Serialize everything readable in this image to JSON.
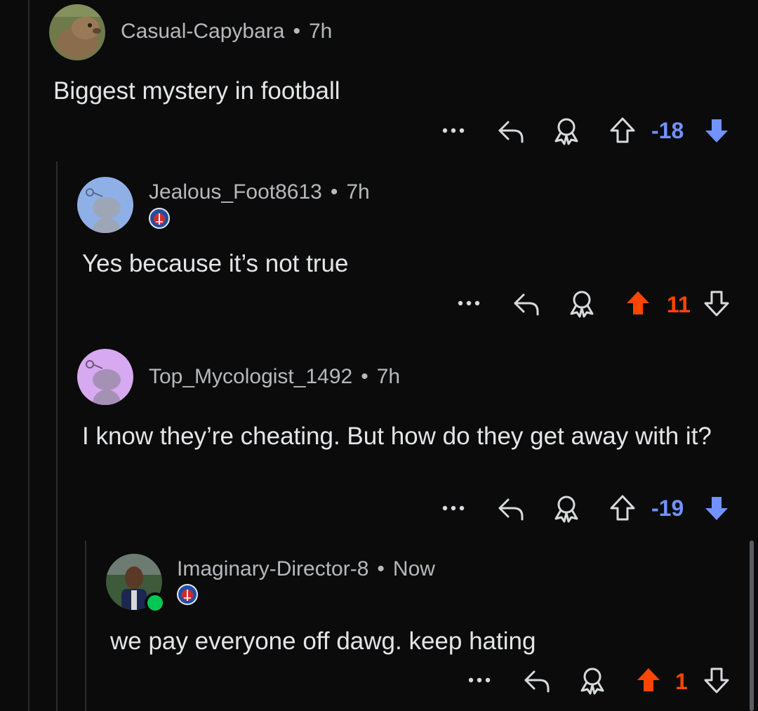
{
  "comments": [
    {
      "author": "Casual-Capybara",
      "time": "7h",
      "text": "Biggest mystery in football",
      "score": "-18",
      "vote": "down",
      "flair": false,
      "avatar": "capybara-photo"
    },
    {
      "author": "Jealous_Foot8613",
      "time": "7h",
      "text": "Yes because it’s not true",
      "score": "11",
      "vote": "up",
      "flair": true,
      "avatar": "snoo-default"
    },
    {
      "author": "Top_Mycologist_1492",
      "time": "7h",
      "text": "I know they’re cheating. But how do they get away with it?",
      "score": "-19",
      "vote": "down",
      "flair": false,
      "avatar": "snoo-default"
    },
    {
      "author": "Imaginary-Director-8",
      "time": "Now",
      "text": "we pay everyone off dawg. keep hating",
      "score": "1",
      "vote": "up",
      "flair": true,
      "avatar": "player-photo",
      "online": true
    }
  ],
  "separator": "•",
  "icons": {
    "more": "more-horizontal-icon",
    "reply": "reply-arrow-icon",
    "award": "award-icon",
    "upvote": "upvote-arrow-icon",
    "downvote": "downvote-arrow-icon",
    "flair": "psg-crest-icon"
  },
  "colors": {
    "background": "#0b0b0b",
    "downvote_active": "#7193ff",
    "upvote_active": "#ff4500",
    "text": "#e3e5e7",
    "meta": "#b6b9bc"
  }
}
